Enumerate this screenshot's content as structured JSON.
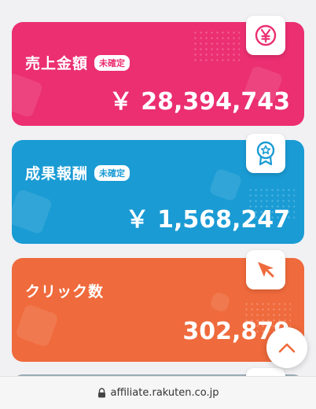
{
  "colors": {
    "sales": "#eb2f71",
    "reward": "#1a9bd4",
    "clicks": "#ef6a3c",
    "fourth": "#9aaab4"
  },
  "cards": [
    {
      "title": "売上金額",
      "badge": "未確定",
      "value": "￥ 28,394,743",
      "icon": "yen-icon"
    },
    {
      "title": "成果報酬",
      "badge": "未確定",
      "value": "￥ 1,568,247",
      "icon": "award-ribbon-icon"
    },
    {
      "title": "クリック数",
      "value": "302,879",
      "icon": "cursor-arrow-icon"
    }
  ],
  "scroll_top": {
    "icon": "chevron-up-icon"
  },
  "urlbar": {
    "icon": "lock-icon",
    "url": "affiliate.rakuten.co.jp"
  }
}
